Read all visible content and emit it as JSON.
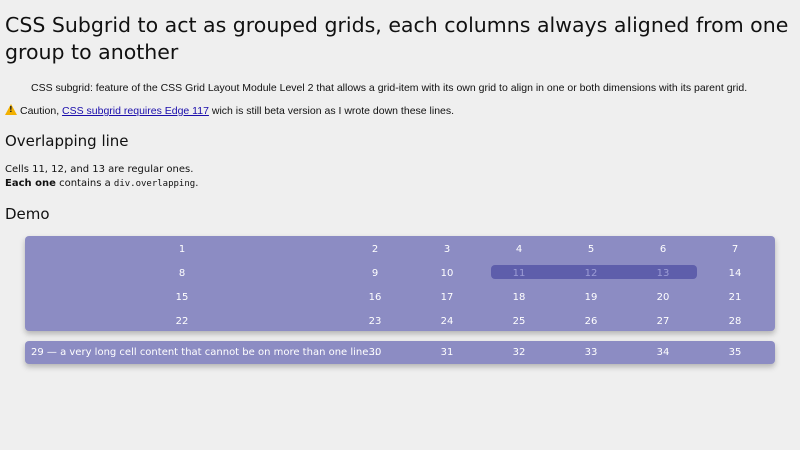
{
  "page": {
    "title": "CSS Subgrid to act as grouped grids, each columns always aligned from one group to another",
    "definition": "CSS subgrid: feature of the CSS Grid Layout Module Level 2 that allows a grid-item with its own grid to align in one or both dimensions with its parent grid.",
    "caution_prefix": "Caution,",
    "caution_link": "CSS subgrid requires Edge 117",
    "caution_suffix": "wich is still beta version as I wrote down these lines.",
    "section_overlapping": "Overlapping line",
    "cells_line": "Cells 11, 12, and 13 are regular ones.",
    "each_one": "Each one",
    "contains_a": "contains a",
    "code": "div.overlapping",
    "period": ".",
    "section_demo": "Demo"
  },
  "grid1": [
    [
      "1",
      "2",
      "3",
      "4",
      "5",
      "6",
      "7"
    ],
    [
      "8",
      "9",
      "10",
      "11",
      "12",
      "13",
      "14"
    ],
    [
      "15",
      "16",
      "17",
      "18",
      "19",
      "20",
      "21"
    ],
    [
      "22",
      "23",
      "24",
      "25",
      "26",
      "27",
      "28"
    ]
  ],
  "grid2": [
    [
      "29 — a very long cell content that cannot be on more than one line...",
      "30",
      "31",
      "32",
      "33",
      "34",
      "35"
    ]
  ],
  "colors": {
    "background": "#efefef",
    "grid_bg": "#8c8cc3",
    "overlapping_bg": "#5e5eab",
    "link": "#1a0dab",
    "warning": "#f2b000"
  },
  "icons": {
    "caution": "warning-icon"
  }
}
